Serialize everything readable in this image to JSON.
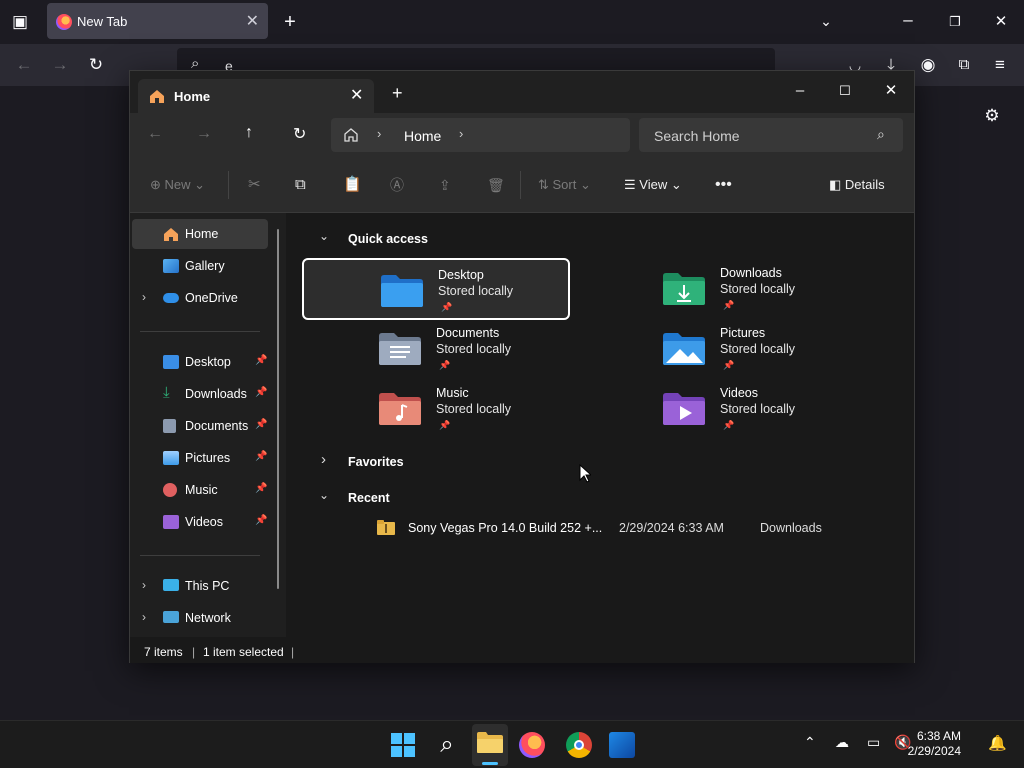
{
  "browser": {
    "tab_title": "New Tab",
    "url_value": "e"
  },
  "explorer": {
    "tab_title": "Home",
    "breadcrumb": "Home",
    "search_placeholder": "Search Home",
    "toolbar": {
      "new": "New",
      "sort": "Sort",
      "view": "View",
      "details": "Details"
    },
    "sidebar": {
      "top": [
        {
          "label": "Home",
          "icon": "home-icon",
          "selected": true
        },
        {
          "label": "Gallery",
          "icon": "gallery-icon"
        },
        {
          "label": "OneDrive",
          "icon": "cloud-icon",
          "expandable": true
        }
      ],
      "pinned": [
        {
          "label": "Desktop",
          "icon": "desktop-folder-icon",
          "color": "#3a8ee6"
        },
        {
          "label": "Downloads",
          "icon": "download-folder-icon",
          "color": "#2fb27a"
        },
        {
          "label": "Documents",
          "icon": "documents-folder-icon",
          "color": "#8c9aaf"
        },
        {
          "label": "Pictures",
          "icon": "pictures-folder-icon",
          "color": "#3d9be9"
        },
        {
          "label": "Music",
          "icon": "music-folder-icon",
          "color": "#e06060"
        },
        {
          "label": "Videos",
          "icon": "videos-folder-icon",
          "color": "#9a62d8"
        }
      ],
      "bottom": [
        {
          "label": "This PC",
          "icon": "pc-icon"
        },
        {
          "label": "Network",
          "icon": "network-icon"
        }
      ]
    },
    "sections": {
      "quick_access": "Quick access",
      "favorites": "Favorites",
      "recent": "Recent"
    },
    "quick_access": [
      {
        "name": "Desktop",
        "sub": "Stored locally",
        "color": "#3a8ee6",
        "selected": true
      },
      {
        "name": "Downloads",
        "sub": "Stored locally",
        "color": "#2fb27a"
      },
      {
        "name": "Documents",
        "sub": "Stored locally",
        "color": "#8c9aaf"
      },
      {
        "name": "Pictures",
        "sub": "Stored locally",
        "color": "#3d9be9"
      },
      {
        "name": "Music",
        "sub": "Stored locally",
        "color": "#e07070"
      },
      {
        "name": "Videos",
        "sub": "Stored locally",
        "color": "#9a62d8"
      }
    ],
    "recent": [
      {
        "name": "Sony Vegas Pro 14.0 Build 252 +...",
        "date": "2/29/2024 6:33 AM",
        "location": "Downloads"
      }
    ],
    "status": {
      "items": "7 items",
      "selected": "1 item selected"
    }
  },
  "taskbar": {
    "time": "6:38 AM",
    "date": "2/29/2024"
  }
}
